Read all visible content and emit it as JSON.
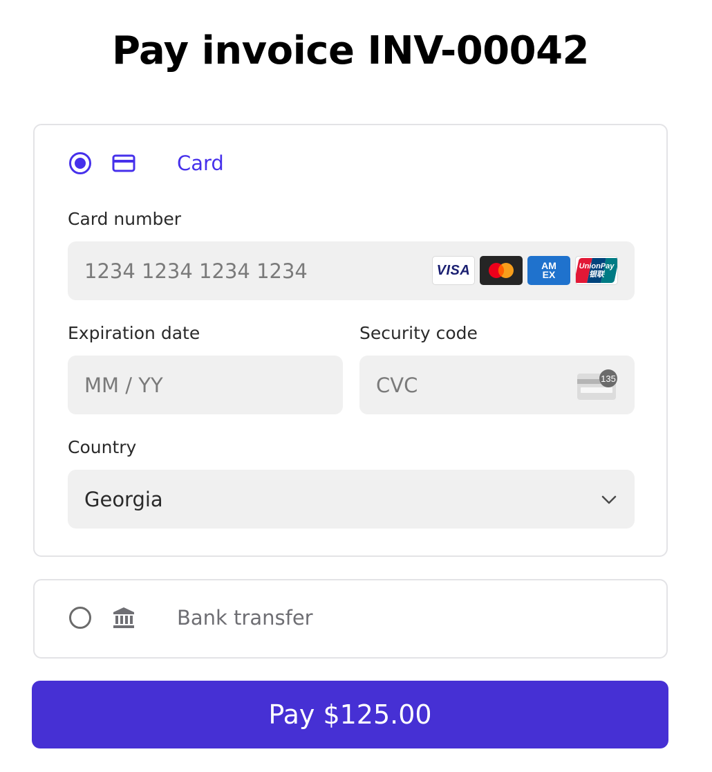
{
  "page": {
    "title": "Pay invoice INV-00042"
  },
  "payment_options": {
    "card": {
      "label": "Card",
      "selected": true,
      "icon": "credit-card-icon",
      "accent_color": "#4630eb"
    },
    "bank": {
      "label": "Bank transfer",
      "selected": false,
      "icon": "bank-icon"
    }
  },
  "card_form": {
    "card_number": {
      "label": "Card number",
      "placeholder": "1234 1234 1234 1234",
      "brands": [
        "VISA",
        "Mastercard",
        "AMEX",
        "UnionPay"
      ],
      "brand_text": {
        "visa": "VISA",
        "amex_top": "AM",
        "amex_bottom": "EX",
        "unionpay": "UnionPay",
        "unionpay_cn": "银联"
      }
    },
    "expiration": {
      "label": "Expiration date",
      "placeholder": "MM / YY"
    },
    "security": {
      "label": "Security code",
      "placeholder": "CVC",
      "icon": "cvc-card-icon",
      "icon_badge": "135"
    },
    "country": {
      "label": "Country",
      "value": "Georgia",
      "icon": "chevron-down-icon"
    }
  },
  "pay_button": {
    "label": "Pay $125.00",
    "color": "#4630d4"
  }
}
